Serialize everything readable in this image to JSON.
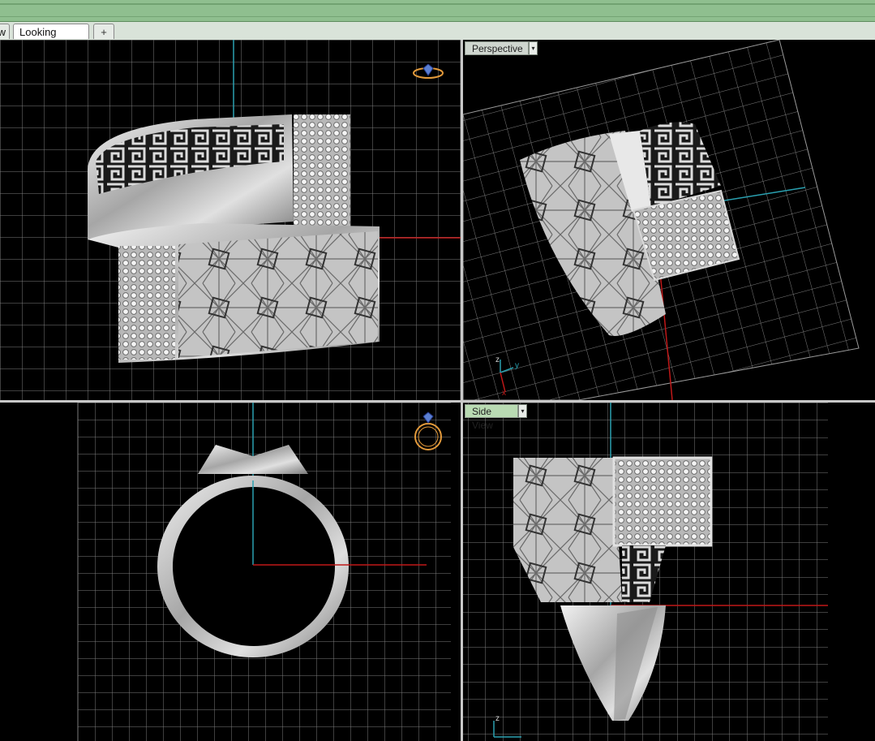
{
  "tabs": {
    "partial_label": "w",
    "active_label": "Looking Down",
    "add_label": "+"
  },
  "viewports": {
    "perspective_label": "Perspective",
    "side_label": "Side View",
    "dropdown_glyph": "▾"
  },
  "axes": {
    "z": "z",
    "y": "y",
    "x": "x"
  },
  "icons": [
    "add-tab-icon",
    "dropdown-arrow-icon",
    "ring-nav-icon",
    "axis-triad-icon"
  ],
  "colors": {
    "grid": "#8a8a8a",
    "x_axis": "#c01818",
    "y_axis": "#2aa0b0",
    "nav_icon": "#e39a3b",
    "metal": "#c9c9c9",
    "title_bar": "#8fbf8f"
  }
}
